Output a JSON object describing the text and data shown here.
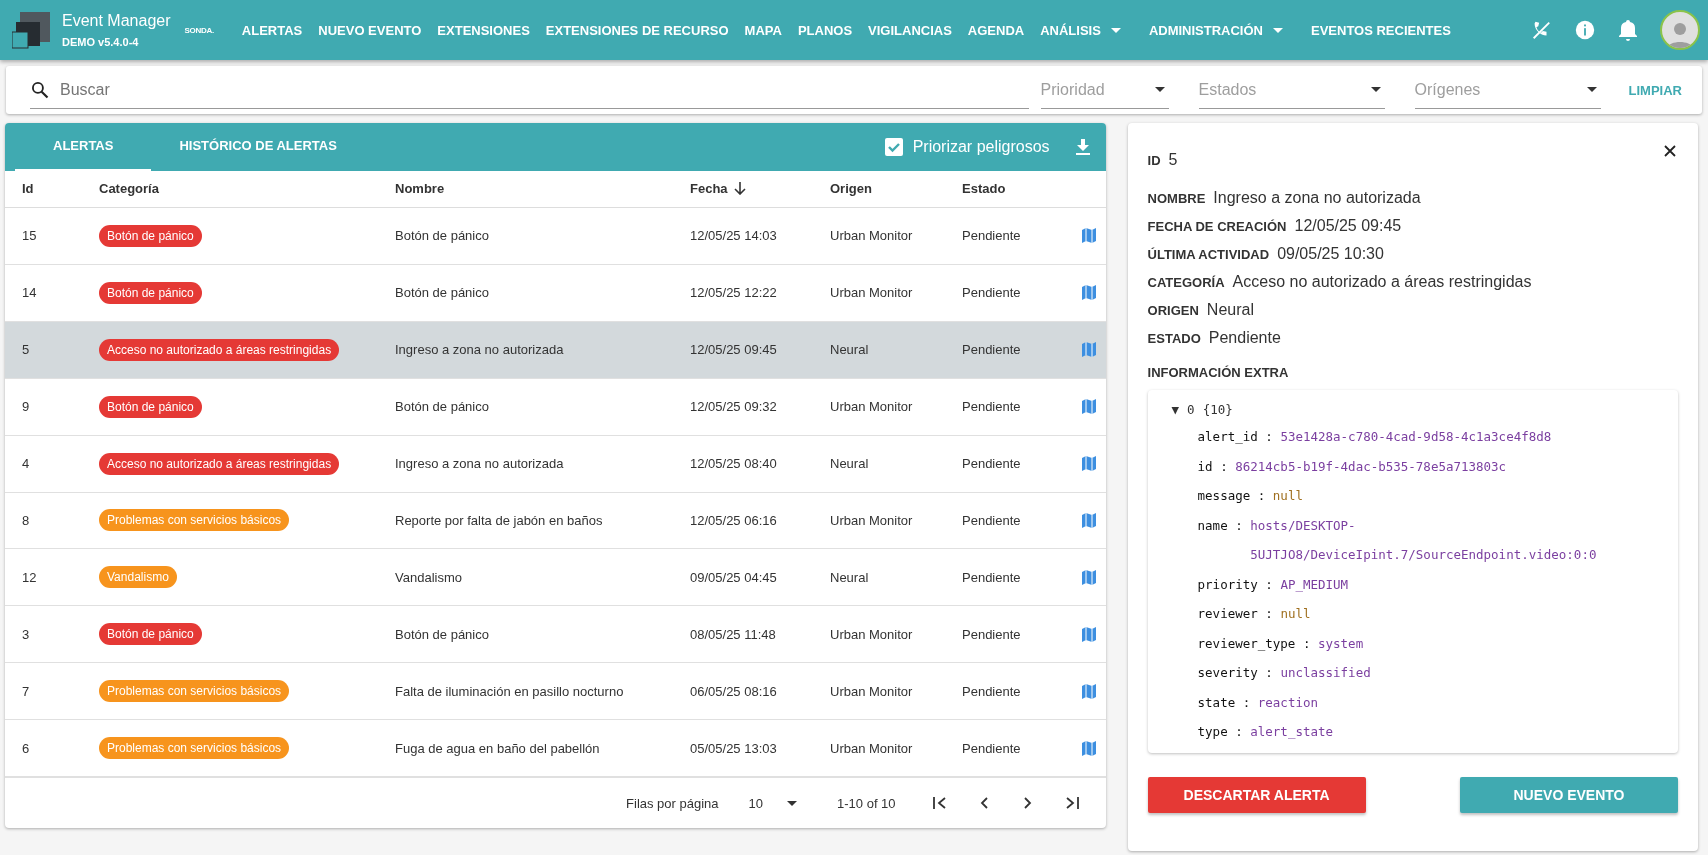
{
  "app": {
    "title": "Event Manager",
    "version": "DEMO v5.4.0-4",
    "partner_logo": "SONDA."
  },
  "nav": [
    {
      "label": "ALERTAS",
      "kind": "link"
    },
    {
      "label": "NUEVO EVENTO",
      "kind": "link"
    },
    {
      "label": "EXTENSIONES",
      "kind": "link"
    },
    {
      "label": "EXTENSIONES DE RECURSO",
      "kind": "link"
    },
    {
      "label": "MAPA",
      "kind": "link"
    },
    {
      "label": "PLANOS",
      "kind": "link"
    },
    {
      "label": "VIGILANCIAS",
      "kind": "link"
    },
    {
      "label": "AGENDA",
      "kind": "link"
    },
    {
      "label": "ANÁLISIS",
      "kind": "menu"
    },
    {
      "label": "ADMINISTRACIÓN",
      "kind": "menu"
    },
    {
      "label": "EVENTOS RECIENTES",
      "kind": "link"
    }
  ],
  "filters": {
    "search_placeholder": "Buscar",
    "selects": [
      {
        "placeholder": "Prioridad"
      },
      {
        "placeholder": "Estados"
      },
      {
        "placeholder": "Orígenes"
      }
    ],
    "clear": "LIMPIAR"
  },
  "tabs": [
    {
      "label": "ALERTAS",
      "selected": true
    },
    {
      "label": "HISTÓRICO DE ALERTAS",
      "selected": false
    }
  ],
  "prioritize": {
    "label": "Priorizar peligrosos",
    "checked": true
  },
  "table": {
    "columns": [
      {
        "label": "Id",
        "sorted": false
      },
      {
        "label": "Categoría",
        "sorted": false
      },
      {
        "label": "Nombre",
        "sorted": false
      },
      {
        "label": "Fecha",
        "sorted": true
      },
      {
        "label": "Origen",
        "sorted": false
      },
      {
        "label": "Estado",
        "sorted": false
      }
    ],
    "rows": [
      {
        "id": "15",
        "category": "Botón de pánico",
        "color": "#e53935",
        "name": "Botón de pánico",
        "date": "12/05/25 14:03",
        "origin": "Urban Monitor",
        "state": "Pendiente",
        "selected": false
      },
      {
        "id": "14",
        "category": "Botón de pánico",
        "color": "#e53935",
        "name": "Botón de pánico",
        "date": "12/05/25 12:22",
        "origin": "Urban Monitor",
        "state": "Pendiente",
        "selected": false
      },
      {
        "id": "5",
        "category": "Acceso no autorizado a áreas restringidas",
        "color": "#e53935",
        "name": "Ingreso a zona no autorizada",
        "date": "12/05/25 09:45",
        "origin": "Neural",
        "state": "Pendiente",
        "selected": true
      },
      {
        "id": "9",
        "category": "Botón de pánico",
        "color": "#e53935",
        "name": "Botón de pánico",
        "date": "12/05/25 09:32",
        "origin": "Urban Monitor",
        "state": "Pendiente",
        "selected": false
      },
      {
        "id": "4",
        "category": "Acceso no autorizado a áreas restringidas",
        "color": "#e53935",
        "name": "Ingreso a zona no autorizada",
        "date": "12/05/25 08:40",
        "origin": "Neural",
        "state": "Pendiente",
        "selected": false
      },
      {
        "id": "8",
        "category": "Problemas con servicios básicos",
        "color": "#f7941d",
        "name": "Reporte por falta de jabón en baños",
        "date": "12/05/25 06:16",
        "origin": "Urban Monitor",
        "state": "Pendiente",
        "selected": false
      },
      {
        "id": "12",
        "category": "Vandalismo",
        "color": "#f7941d",
        "name": "Vandalismo",
        "date": "09/05/25 04:45",
        "origin": "Neural",
        "state": "Pendiente",
        "selected": false
      },
      {
        "id": "3",
        "category": "Botón de pánico",
        "color": "#e53935",
        "name": "Botón de pánico",
        "date": "08/05/25 11:48",
        "origin": "Urban Monitor",
        "state": "Pendiente",
        "selected": false
      },
      {
        "id": "7",
        "category": "Problemas con servicios básicos",
        "color": "#f7941d",
        "name": "Falta de iluminación en pasillo nocturno",
        "date": "06/05/25 08:16",
        "origin": "Urban Monitor",
        "state": "Pendiente",
        "selected": false
      },
      {
        "id": "6",
        "category": "Problemas con servicios básicos",
        "color": "#f7941d",
        "name": "Fuga de agua en baño del pabellón",
        "date": "05/05/25 13:03",
        "origin": "Urban Monitor",
        "state": "Pendiente",
        "selected": false
      }
    ]
  },
  "pagination": {
    "label": "Filas por página",
    "per_page": "10",
    "range": "1-10 of 10"
  },
  "detail": {
    "id_label": "ID",
    "id": "5",
    "fields": [
      {
        "label": "NOMBRE",
        "value": "Ingreso a zona no autorizada"
      },
      {
        "label": "FECHA DE CREACIÓN",
        "value": "12/05/25 09:45"
      },
      {
        "label": "ÚLTIMA ACTIVIDAD",
        "value": "09/05/25 10:30"
      },
      {
        "label": "CATEGORÍA",
        "value": "Acceso no autorizado a áreas restringidas"
      },
      {
        "label": "ORIGEN",
        "value": "Neural"
      },
      {
        "label": "ESTADO",
        "value": "Pendiente"
      }
    ],
    "extra_title": "INFORMACIÓN EXTRA",
    "tree": {
      "toggle": "▼",
      "index": "0",
      "count": "{10}",
      "expanded": true,
      "separator": ":",
      "entries": [
        {
          "key": "alert_id",
          "value": "53e1428a-c780-4cad-9d58-4c1a3ce4f8d8",
          "kind": "string"
        },
        {
          "key": "id",
          "value": "86214cb5-b19f-4dac-b535-78e5a713803c",
          "kind": "string"
        },
        {
          "key": "message",
          "value": "null",
          "kind": "null"
        },
        {
          "key": "name",
          "value": "hosts/DESKTOP-5UJTJO8/DeviceIpint.7/SourceEndpoint.video:0:0",
          "kind": "string"
        },
        {
          "key": "priority",
          "value": "AP_MEDIUM",
          "kind": "string"
        },
        {
          "key": "reviewer",
          "value": "null",
          "kind": "null"
        },
        {
          "key": "reviewer_type",
          "value": "system",
          "kind": "string"
        },
        {
          "key": "severity",
          "value": "unclassified",
          "kind": "string"
        },
        {
          "key": "state",
          "value": "reaction",
          "kind": "string"
        },
        {
          "key": "type",
          "value": "alert_state",
          "kind": "string"
        }
      ]
    },
    "actions": [
      {
        "label": "DESCARTAR ALERTA",
        "kind": "danger"
      },
      {
        "label": "NUEVO EVENTO",
        "kind": "primary"
      }
    ]
  }
}
